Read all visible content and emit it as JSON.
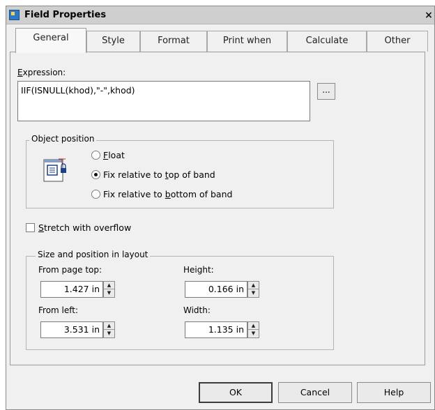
{
  "window": {
    "title": "Field Properties",
    "close_glyph": "×"
  },
  "tabs": [
    {
      "label": "General",
      "active": true
    },
    {
      "label": "Style",
      "active": false
    },
    {
      "label": "Format",
      "active": false
    },
    {
      "label": "Print when",
      "active": false
    },
    {
      "label": "Calculate",
      "active": false
    },
    {
      "label": "Other",
      "active": false
    }
  ],
  "expression": {
    "label_prefix": "",
    "label_accel": "E",
    "label_rest": "xpression:",
    "value": "IIF(ISNULL(khod),\"-\",khod)",
    "browse_label": "..."
  },
  "object_position": {
    "legend": "Object position",
    "options": [
      {
        "accel": "F",
        "rest_before": "",
        "rest_after": "loat",
        "checked": false
      },
      {
        "before": "Fix relative to ",
        "accel": "t",
        "after": "op of band",
        "checked": true
      },
      {
        "before": "Fix relative to ",
        "accel": "b",
        "after": "ottom of band",
        "checked": false
      }
    ],
    "icon": "object-position-icon"
  },
  "stretch": {
    "accel": "S",
    "rest": "tretch with overflow",
    "checked": false
  },
  "size_position": {
    "legend": "Size and position in layout",
    "from_page_top": {
      "label": "From page top:",
      "value": "1.427 in"
    },
    "height": {
      "label": "Height:",
      "value": "0.166 in"
    },
    "from_left": {
      "label": "From left:",
      "value": "3.531 in"
    },
    "width": {
      "label": "Width:",
      "value": "1.135 in"
    }
  },
  "buttons": {
    "ok": "OK",
    "cancel": "Cancel",
    "help": "Help"
  },
  "colors": {
    "dialog_bg": "#f0f0f0",
    "titlebar_bg": "#cfcfcf",
    "icon_blue": "#2f78c6"
  }
}
